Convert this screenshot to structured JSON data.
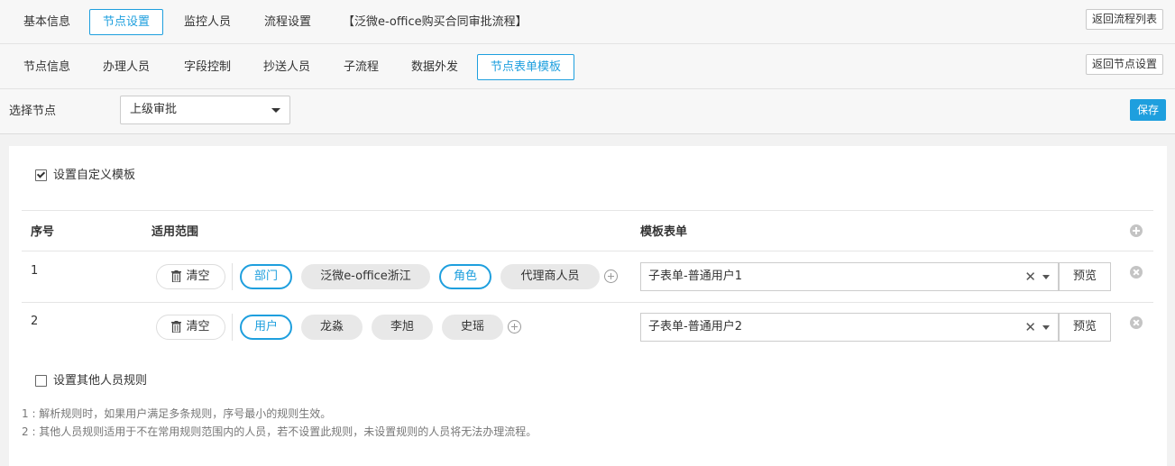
{
  "top_tabs": [
    "基本信息",
    "节点设置",
    "监控人员",
    "流程设置"
  ],
  "breadcrumb": "【泛微e-office购买合同审批流程】",
  "back_flow_list": "返回流程列表",
  "sub_tabs": [
    "节点信息",
    "办理人员",
    "字段控制",
    "抄送人员",
    "子流程",
    "数据外发",
    "节点表单模板"
  ],
  "back_node_settings": "返回节点设置",
  "node_select": {
    "label": "选择节点",
    "value": "上级审批"
  },
  "save_label": "保存",
  "custom_template": {
    "label": "设置自定义模板",
    "checked": true
  },
  "table": {
    "headers": [
      "序号",
      "适用范围",
      "模板表单"
    ],
    "clear_label": "清空",
    "preview_label": "预览",
    "rows": [
      {
        "index": "1",
        "scope": [
          "部门",
          "泛微e-office浙江",
          "角色",
          "代理商人员"
        ],
        "template": "子表单-普通用户1"
      },
      {
        "index": "2",
        "scope": [
          "用户",
          "龙淼",
          "李旭",
          "史瑶"
        ],
        "template": "子表单-普通用户2"
      }
    ]
  },
  "other_rules": {
    "label": "设置其他人员规则",
    "checked": false
  },
  "notes": [
    "1 : 解析规则时，如果用户满足多条规则，序号最小的规则生效。",
    "2 : 其他人员规则适用于不在常用规则范围内的人员，若不设置此规则，未设置规则的人员将无法办理流程。"
  ],
  "colors": {
    "accent": "#1e9fde",
    "chip_bg": "#e8e8e8",
    "note_text": "#777777"
  },
  "icons": [
    "trash-icon",
    "add-circle-icon",
    "remove-circle-icon",
    "clear-x-icon",
    "caret-down-icon",
    "checkbox-icon"
  ]
}
